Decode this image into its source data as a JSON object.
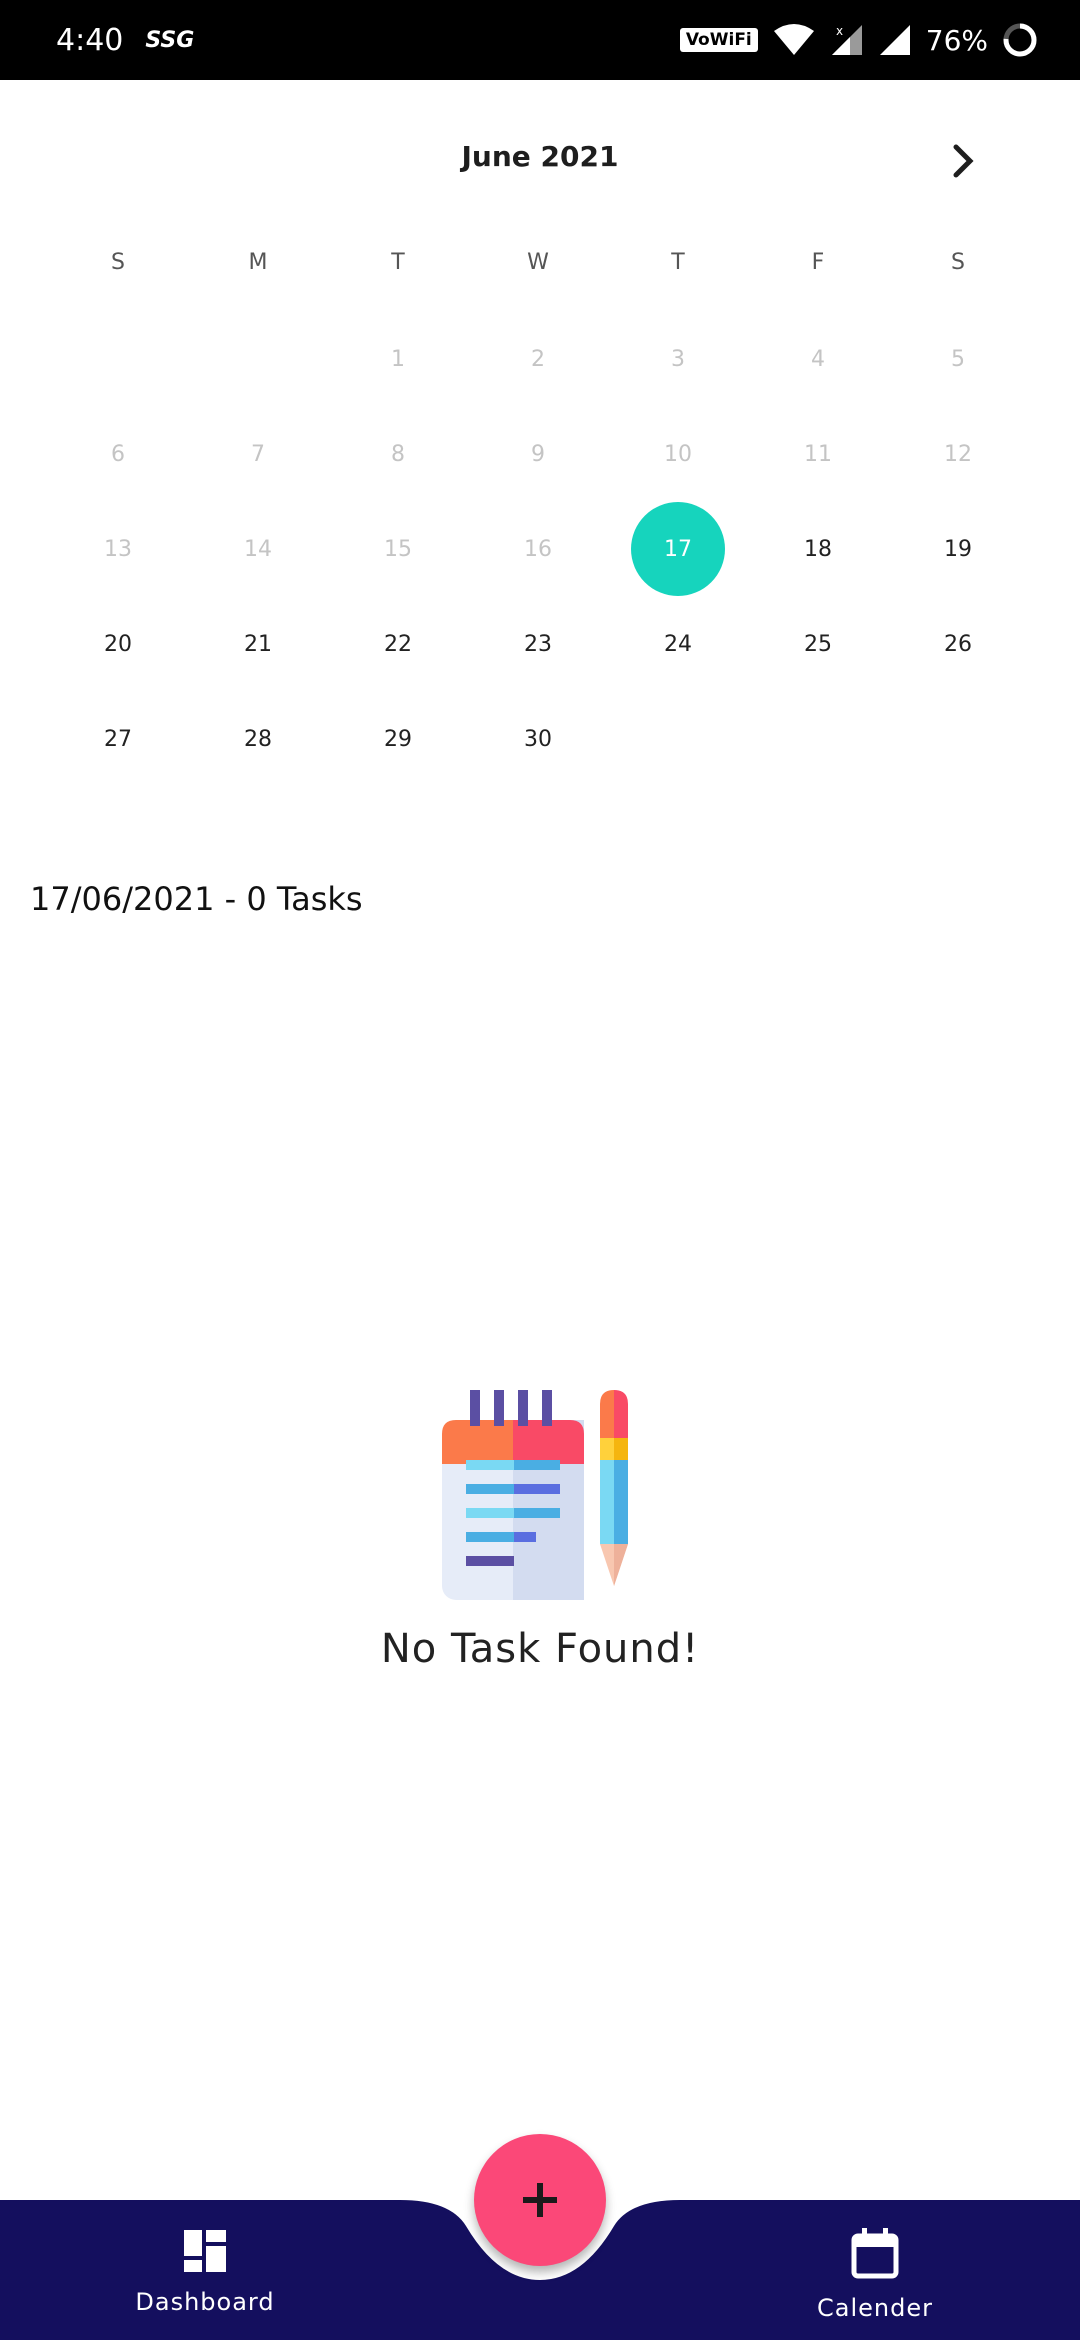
{
  "status_bar": {
    "time": "4:40",
    "carrier": "SSG",
    "wifi_badge": "VoWiFi",
    "battery": "76%"
  },
  "calendar": {
    "month_title": "June 2021",
    "next_icon": "chevron-right-icon",
    "weekdays": [
      "S",
      "M",
      "T",
      "W",
      "T",
      "F",
      "S"
    ],
    "selected_day": "17",
    "selected_color": "#16d4bd",
    "weeks": [
      [
        "",
        "",
        "1",
        "2",
        "3",
        "4",
        "5"
      ],
      [
        "6",
        "7",
        "8",
        "9",
        "10",
        "11",
        "12"
      ],
      [
        "13",
        "14",
        "15",
        "16",
        "17",
        "18",
        "19"
      ],
      [
        "20",
        "21",
        "22",
        "23",
        "24",
        "25",
        "26"
      ],
      [
        "27",
        "28",
        "29",
        "30",
        "",
        "",
        ""
      ]
    ]
  },
  "tasks": {
    "summary": "17/06/2021 - 0 Tasks"
  },
  "empty_state": {
    "icon": "notepad-pencil-icon",
    "message": "No Task Found!"
  },
  "fab": {
    "icon": "plus-icon",
    "color": "#fb4878"
  },
  "bottom_nav": {
    "background": "#140f5e",
    "items": [
      {
        "label": "Dashboard",
        "icon": "dashboard-icon"
      },
      {
        "label": "Calender",
        "icon": "calendar-icon"
      }
    ]
  }
}
